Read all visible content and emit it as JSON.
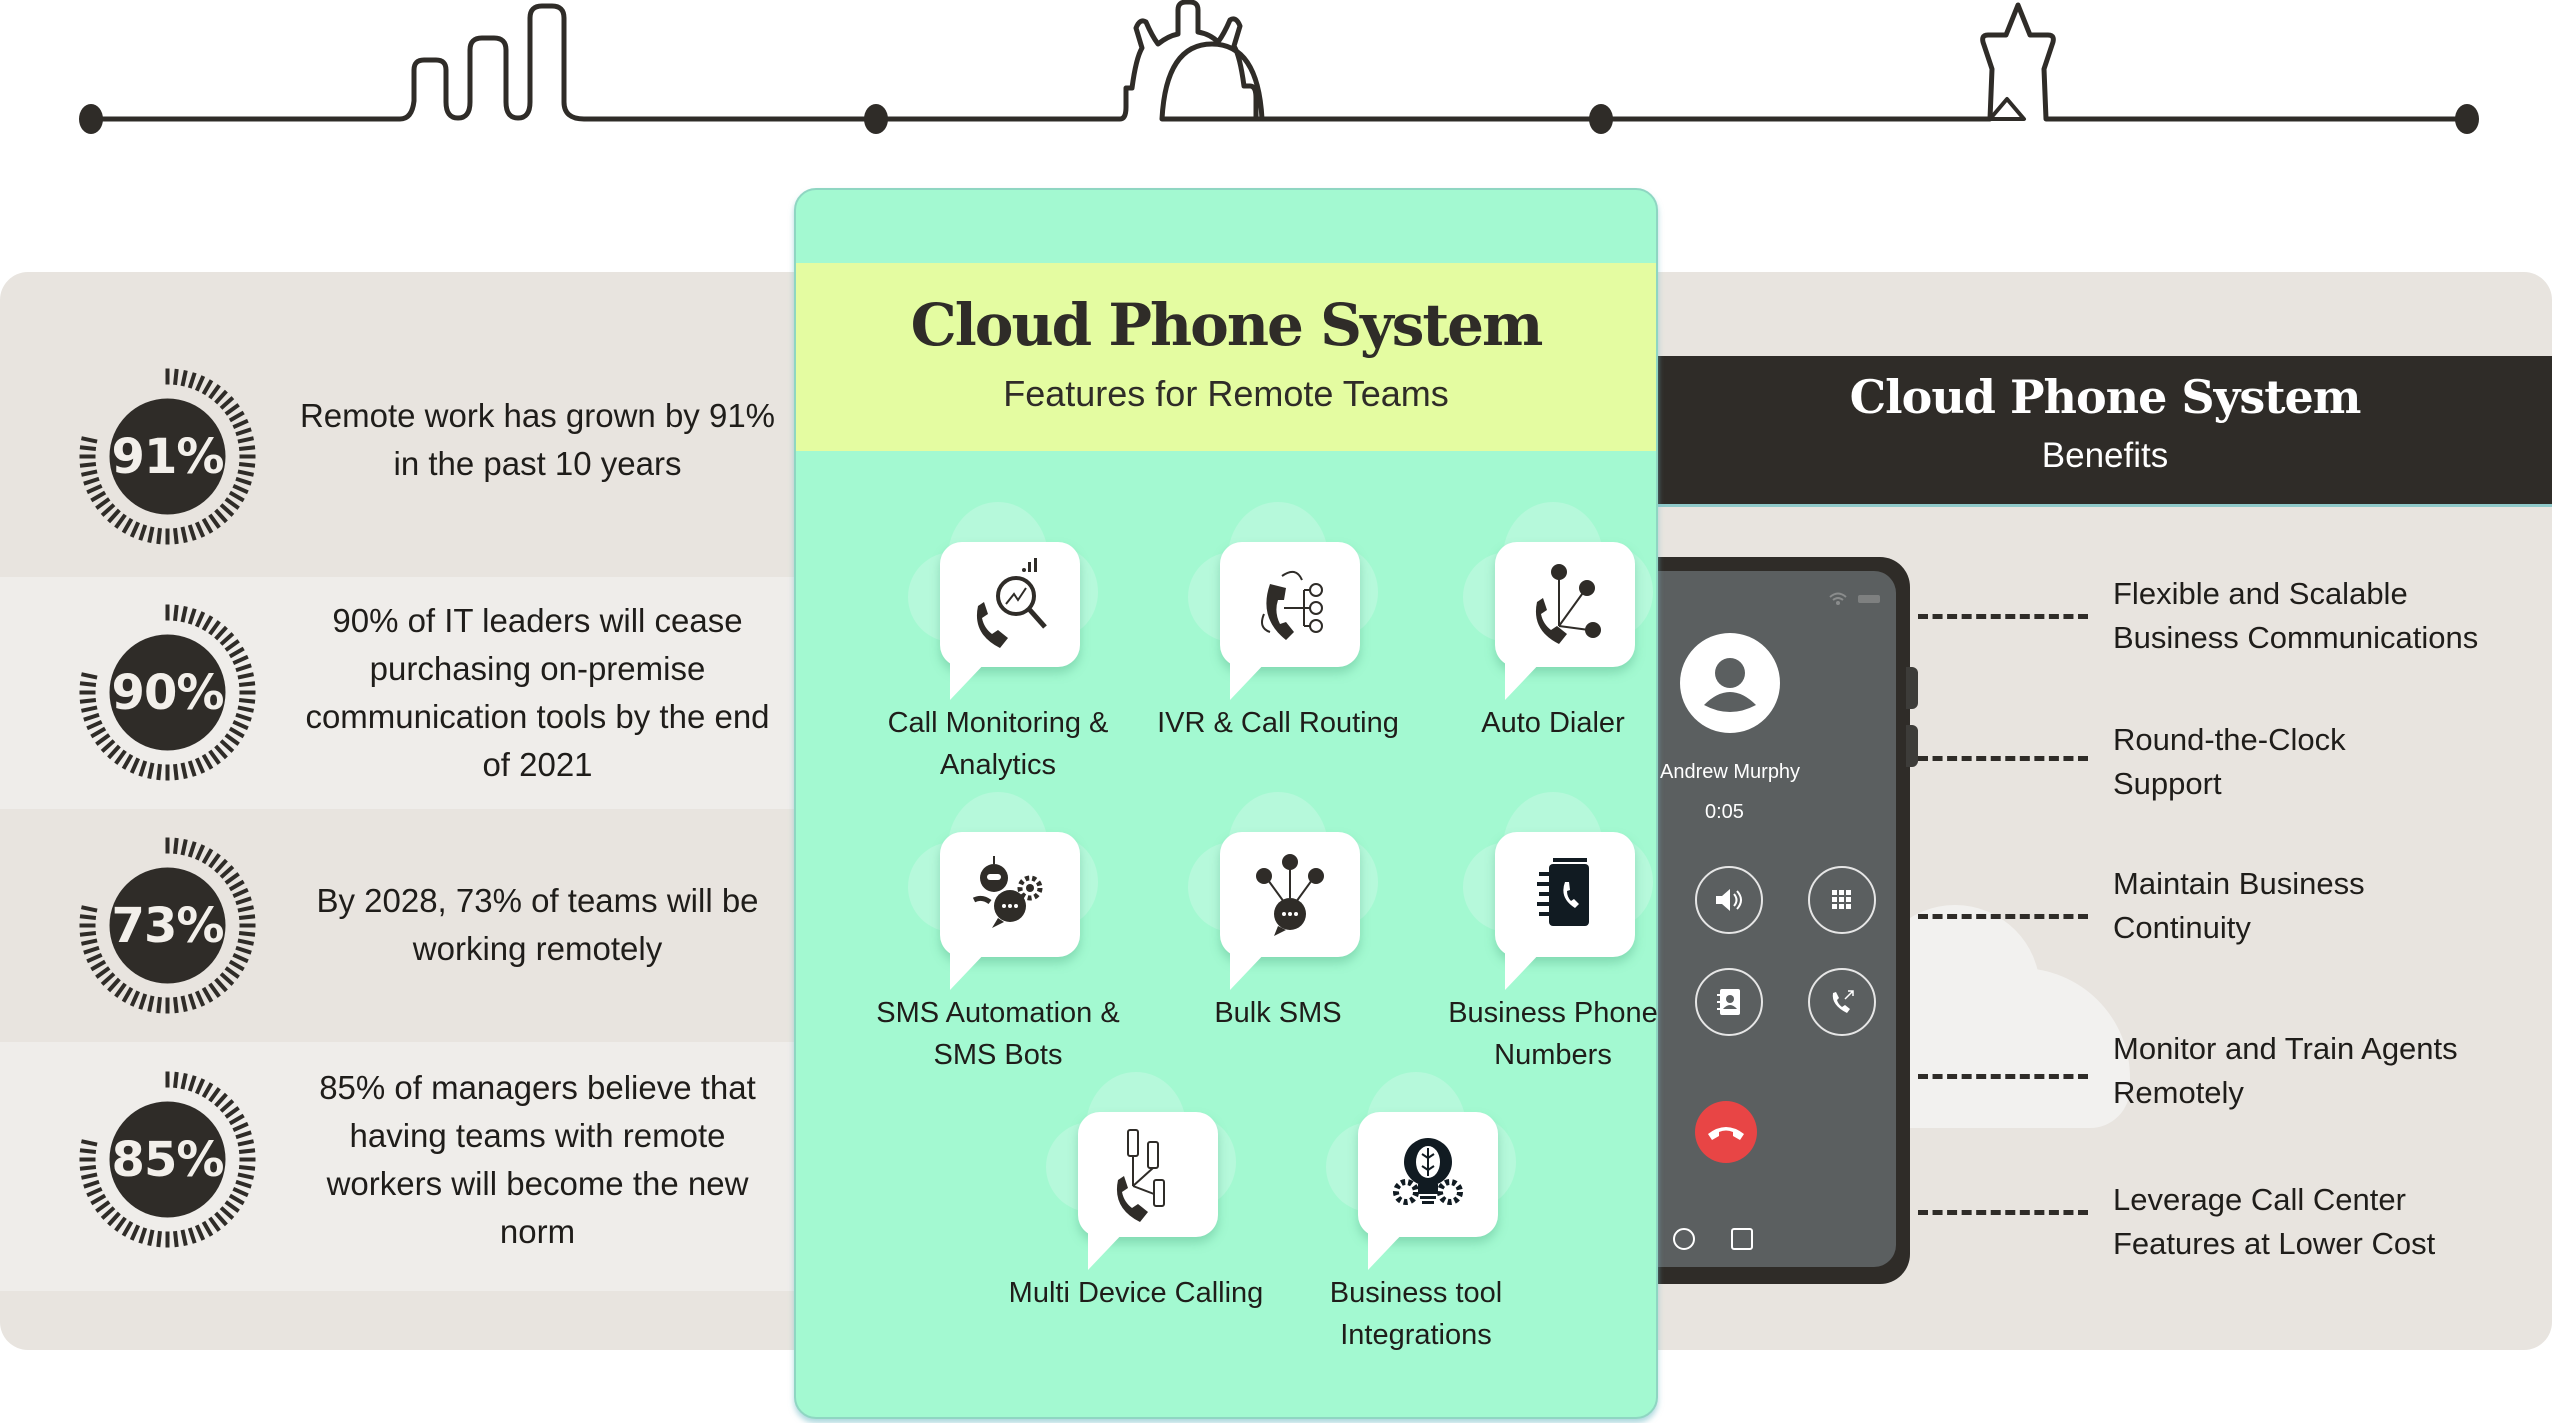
{
  "timeline": {
    "milestones": [
      "bar-chart-icon",
      "gear-icon",
      "star-icon"
    ],
    "color": "#2f2c28"
  },
  "stats": [
    {
      "value": "91%",
      "text": "Remote work has grown by 91% in the past 10 years"
    },
    {
      "value": "90%",
      "text": "90% of IT leaders will cease purchasing on-premise communication tools by the end of 2021"
    },
    {
      "value": "73%",
      "text": "By 2028, 73% of teams will be working remotely"
    },
    {
      "value": "85%",
      "text": "85% of managers believe that having teams with remote workers will become the new norm"
    }
  ],
  "features_card": {
    "title": "Cloud Phone System",
    "subtitle": "Features for Remote Teams",
    "items": [
      {
        "label": "Call Monitoring & Analytics",
        "icon": "call-analytics-icon"
      },
      {
        "label": "IVR & Call Routing",
        "icon": "call-routing-icon"
      },
      {
        "label": "Auto Dialer",
        "icon": "auto-dialer-icon"
      },
      {
        "label": "SMS Automation & SMS Bots",
        "icon": "sms-bot-icon"
      },
      {
        "label": "Bulk SMS",
        "icon": "bulk-sms-icon"
      },
      {
        "label": "Business Phone Numbers",
        "icon": "phone-book-icon"
      },
      {
        "label": "Multi Device Calling",
        "icon": "multi-device-icon"
      },
      {
        "label": "Business tool Integrations",
        "icon": "integration-bulb-icon"
      }
    ]
  },
  "benefits": {
    "title": "Cloud Phone System",
    "subtitle": "Benefits",
    "items": [
      "Flexible and Scalable Business Communications",
      "Round-the-Clock Support",
      "Maintain Business Continuity",
      "Monitor and Train Agents Remotely",
      "Leverage Call Center Features at Lower Cost"
    ]
  },
  "phone": {
    "caller_name": "Andrew Murphy",
    "call_time": "0:05",
    "buttons": [
      "speaker",
      "keypad",
      "contacts",
      "transfer"
    ],
    "hangup_color": "#e84545"
  },
  "colors": {
    "mint": "#a3f9d1",
    "lime": "#e4fca1",
    "dark": "#2f2c28",
    "panel": "#e8e4df"
  }
}
